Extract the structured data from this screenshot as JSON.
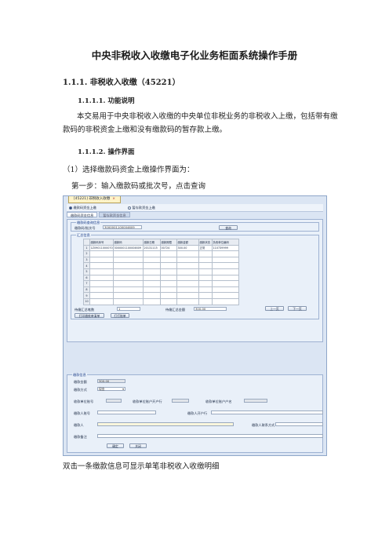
{
  "doc": {
    "title": "中央非税收入收缴电子化业务柜面系统操作手册",
    "heading1": "1.1.1.  非税收入收缴（45221）",
    "heading2": "1.1.1.1.  功能说明",
    "description": "本交易用于中央非税收入收缴的中央单位非税业务的非税收入上缴，包括带有缴款码的非税资金上缴和没有缴款码的暂存款上缴。",
    "heading3": "1.1.1.2.  操作界面",
    "step_intro": "（1）选择缴款码资金上缴操作界面为：",
    "step1": "第一步：输入缴款码或批次号，点击查询",
    "caption": "双击一条缴款信息可显示单笔非税收入收缴明细"
  },
  "screen": {
    "tab_title": "[45221] 非税收入收缴",
    "tab_close": "×",
    "radio_a": "缴款码资金上缴",
    "radio_b": "暂存款资金上缴",
    "subtab_a": "缴款码资金信息",
    "subtab_b": "暂存款资金信息",
    "query_group": "缴款码查询信息",
    "code_label": "缴款码/批次号",
    "code_value": "3000001100004609",
    "query_btn": "查询",
    "grid_group": "汇总信息",
    "grid_headers": [
      "缴款码序号",
      "缴款码",
      "缴款日期",
      "缴款期限",
      "缴款金额",
      "缴款状态",
      "执收单位编码"
    ],
    "grid_rows": [
      [
        "1",
        "1Z09011000070",
        "3000001100004609",
        "20131115",
        "00724",
        "300.00",
        "正常",
        "110739999"
      ],
      [
        "2",
        "",
        "",
        "",
        "",
        "",
        "",
        ""
      ],
      [
        "3",
        "",
        "",
        "",
        "",
        "",
        "",
        ""
      ],
      [
        "4",
        "",
        "",
        "",
        "",
        "",
        "",
        ""
      ],
      [
        "5",
        "",
        "",
        "",
        "",
        "",
        "",
        ""
      ],
      [
        "6",
        "",
        "",
        "",
        "",
        "",
        "",
        ""
      ],
      [
        "7",
        "",
        "",
        "",
        "",
        "",
        "",
        ""
      ],
      [
        "8",
        "",
        "",
        "",
        "",
        "",
        "",
        ""
      ],
      [
        "9",
        "",
        "",
        "",
        "",
        "",
        "",
        ""
      ],
      [
        "10",
        "",
        "",
        "",
        "",
        "",
        "",
        ""
      ]
    ],
    "count_label": "待缴汇总笔数",
    "count_value": "1",
    "sum_label": "待缴汇总金额",
    "sum_value": "300.00",
    "prev_btn": "上一页",
    "next_btn": "下一页",
    "print_list_btn": "打印缴款单清单",
    "print_btn": "打打账单",
    "pay_group": "缴款信息",
    "amount_label": "缴款金额",
    "amount_value": "300.00",
    "method_label": "缴款方式",
    "method_value": "现金",
    "f1": "收款单位账号",
    "f2": "收款单位账户开户行",
    "f3": "收款单位账户户名",
    "f4": "缴款人账号",
    "f5": "缴款人开户行",
    "f6": "缴款人",
    "f7": "缴款人联系方式",
    "f8": "缴款备注",
    "ok_btn": "确定",
    "close_btn": "关闭"
  }
}
